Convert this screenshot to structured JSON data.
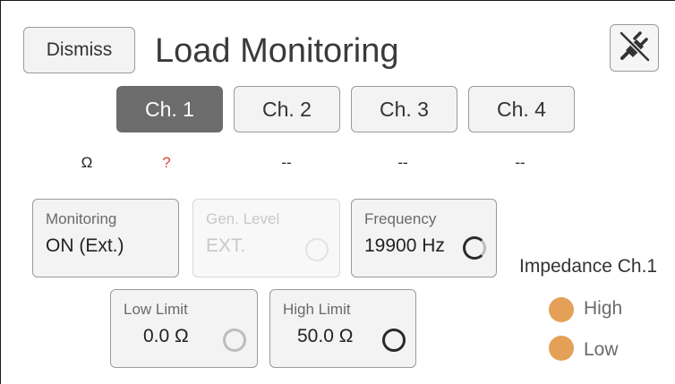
{
  "header": {
    "dismiss_label": "Dismiss",
    "title": "Load Monitoring",
    "mute_icon": "unplug-muted-icon"
  },
  "tabs": [
    {
      "label": "Ch. 1",
      "active": true
    },
    {
      "label": "Ch. 2",
      "active": false
    },
    {
      "label": "Ch. 3",
      "active": false
    },
    {
      "label": "Ch. 4",
      "active": false
    }
  ],
  "status_row": {
    "unit": "Ω",
    "ch1": "?",
    "ch2": "--",
    "ch3": "--",
    "ch4": "--"
  },
  "controls": {
    "monitoring": {
      "label": "Monitoring",
      "value": "ON (Ext.)"
    },
    "gen_level": {
      "label": "Gen. Level",
      "value": "EXT.",
      "disabled": true
    },
    "frequency": {
      "label": "Frequency",
      "value": "19900 Hz"
    },
    "low_limit": {
      "label": "Low Limit",
      "value": "0.0 Ω"
    },
    "high_limit": {
      "label": "High Limit",
      "value": "50.0 Ω"
    }
  },
  "impedance": {
    "title": "Impedance Ch.1",
    "high_label": "High",
    "low_label": "Low",
    "indicator_color": "#e4a057"
  },
  "colors": {
    "active_tab": "#6c6c6c",
    "warning": "#e0443a",
    "indicator": "#e4a057"
  }
}
